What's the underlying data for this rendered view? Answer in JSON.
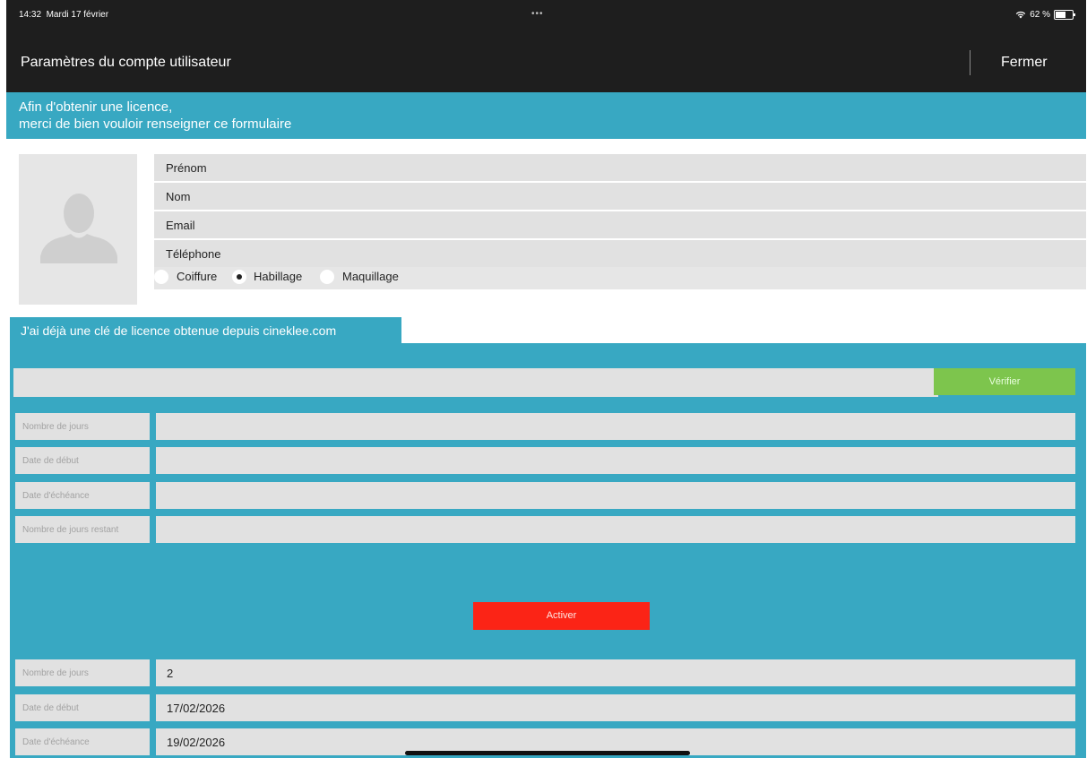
{
  "status_bar": {
    "time": "14:32",
    "date": "Mardi 17 février",
    "dots": "•••",
    "battery": "62 %"
  },
  "header": {
    "title": "Paramètres du compte utilisateur",
    "close_label": "Fermer"
  },
  "banner": {
    "line1": "Afin d'obtenir une licence,",
    "line2": "merci de bien vouloir renseigner ce formulaire"
  },
  "profile": {
    "fields": [
      "Prénom",
      "Nom",
      "Email",
      "Téléphone"
    ],
    "roles": [
      {
        "label": "Coiffure",
        "checked": false
      },
      {
        "label": "Habillage",
        "checked": true
      },
      {
        "label": "Maquillage",
        "checked": false
      }
    ]
  },
  "license": {
    "tab_label": "J'ai déjà une clé de licence obtenue depuis cineklee.com",
    "key_value": "",
    "verify_label": "Vérifier",
    "check_rows": [
      {
        "label": "Nombre de jours",
        "value": ""
      },
      {
        "label": "Date de début",
        "value": ""
      },
      {
        "label": "Date d'échéance",
        "value": ""
      },
      {
        "label": "Nombre de jours restant",
        "value": ""
      }
    ],
    "activate_label": "Activer",
    "current_rows": [
      {
        "label": "Nombre de jours",
        "value": "2"
      },
      {
        "label": "Date de début",
        "value": "17/02/2026"
      },
      {
        "label": "Date d'échéance",
        "value": "19/02/2026"
      }
    ]
  },
  "colors": {
    "dark": "#1e1e1e",
    "accent": "#38a8c2",
    "verify": "#7dc54d",
    "activate": "#fb2416",
    "field": "#e1e1e1"
  }
}
